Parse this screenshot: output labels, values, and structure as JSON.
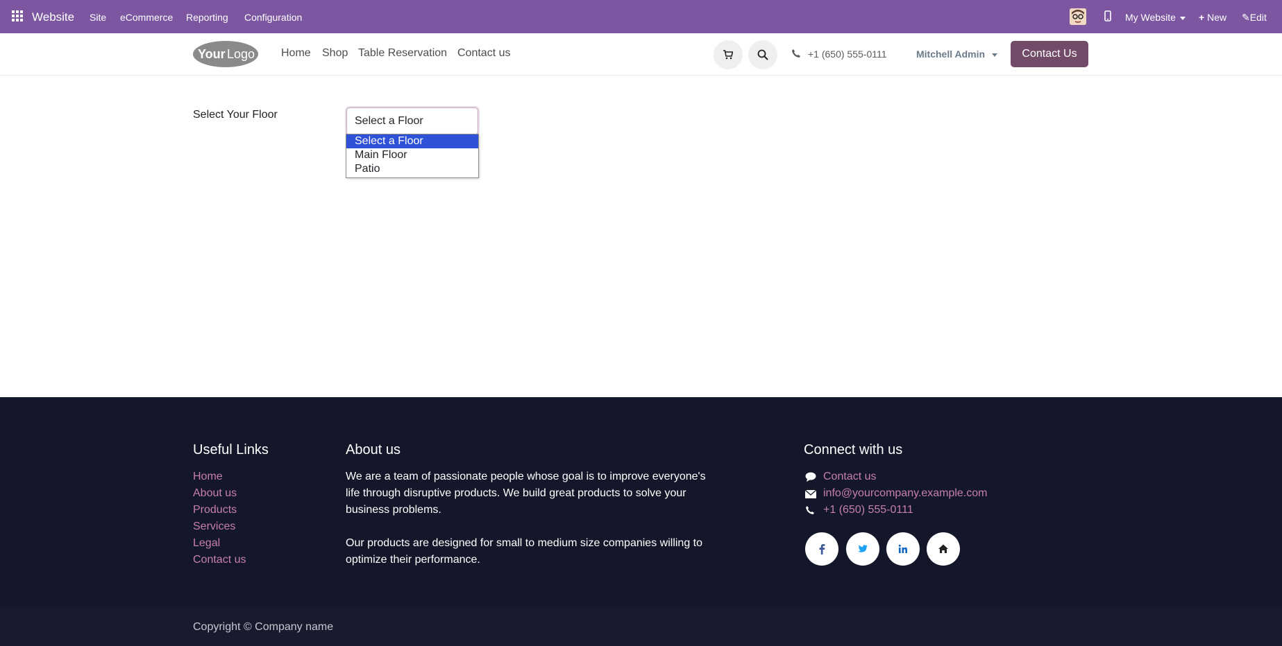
{
  "topbar": {
    "app_name": "Website",
    "menu": [
      "Site",
      "eCommerce",
      "Reporting",
      "Configuration"
    ],
    "website_selector": "My Website",
    "new_label": "New",
    "edit_label": "Edit"
  },
  "navbar": {
    "logo_text": "YourLogo",
    "links": [
      "Home",
      "Shop",
      "Table Reservation",
      "Contact us"
    ],
    "phone": "+1 (650) 555-0111",
    "user": "Mitchell Admin",
    "cta": "Contact Us"
  },
  "main": {
    "floor_label": "Select Your Floor",
    "select_value": "Select a Floor",
    "options": [
      "Select a Floor",
      "Main Floor",
      "Patio"
    ]
  },
  "footer": {
    "useful_links_title": "Useful Links",
    "useful_links": [
      "Home",
      "About us",
      "Products",
      "Services",
      "Legal",
      "Contact us"
    ],
    "about_title": "About us",
    "about_p1_lines": [
      "We are a team of passionate people whose goal is to improve everyone's",
      "life through disruptive products. We build great products to solve your",
      "business problems."
    ],
    "about_p2_lines": [
      "Our products are designed for small to medium size companies willing to",
      "optimize their performance."
    ],
    "connect_title": "Connect with us",
    "connect_contact": "Contact us",
    "connect_email": "info@yourcompany.example.com",
    "connect_phone": "+1 (650) 555-0111",
    "social_icons": [
      "facebook-icon",
      "twitter-icon",
      "linkedin-icon",
      "home-icon"
    ],
    "copyright": "Copyright © Company name"
  },
  "colors": {
    "topbar": "#7c56a1",
    "brand_button": "#714b67",
    "footer_bg": "#14172a",
    "footer_link": "#c77fab",
    "selected_option": "#2f51d8"
  }
}
